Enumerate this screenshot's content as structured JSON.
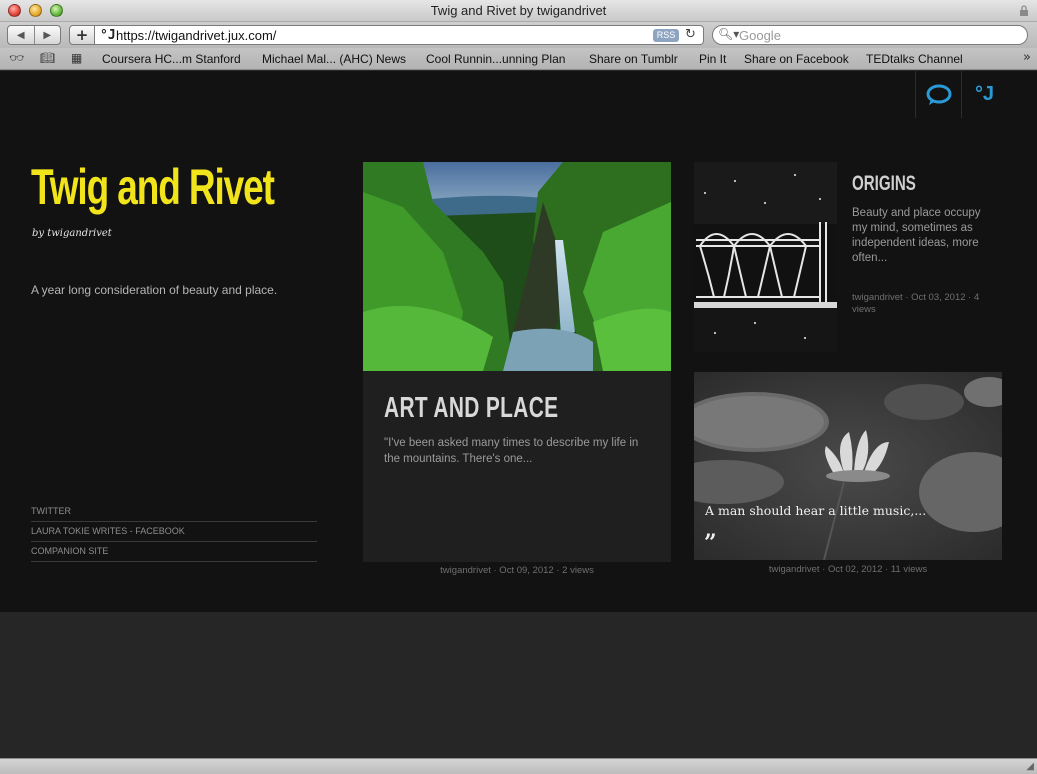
{
  "window": {
    "title": "Twig and Rivet by twigandrivet"
  },
  "toolbar": {
    "back_label": "◀",
    "forward_label": "▶",
    "add_label": "+",
    "url": "https://twigandrivet.jux.com/",
    "rss_label": "RSS",
    "search_placeholder": "Google"
  },
  "bookmarks": [
    {
      "label": "Coursera HC...m Stanford"
    },
    {
      "label": "Michael Mal... (AHC) News"
    },
    {
      "label": "Cool Runnin...unning Plan"
    },
    {
      "label": "Share on Tumblr"
    },
    {
      "label": "Pin It"
    },
    {
      "label": "Share on Facebook"
    },
    {
      "label": "TEDtalks Channel"
    }
  ],
  "site": {
    "title": "Twig and Rivet",
    "byline": "by twigandrivet",
    "tagline": "A year long consideration of beauty and place.",
    "accent_color": "#f2e41b",
    "j_logo": "°J"
  },
  "side_links": [
    {
      "label": "TWITTER"
    },
    {
      "label": "LAURA TOKIE WRITES - FACEBOOK"
    },
    {
      "label": "COMPANION SITE"
    }
  ],
  "posts": {
    "art": {
      "title": "ART AND PLACE",
      "excerpt": "\"I've been asked many times to describe my life in the mountains. There's one...",
      "meta": "twigandrivet · Oct 09, 2012 · 2 views",
      "image_icon": "waterfall-photo"
    },
    "origins": {
      "title": "ORIGINS",
      "excerpt": "Beauty and place occupy my mind, sometimes as independent ideas, more often...",
      "meta": "twigandrivet · Oct 03, 2012 · 4 views",
      "image_icon": "architecture-photo"
    },
    "quote": {
      "text": "A man should hear a little music,...",
      "mark": "”",
      "meta": "twigandrivet · Oct 02, 2012 · 11 views",
      "image_icon": "water-lily-photo"
    }
  }
}
